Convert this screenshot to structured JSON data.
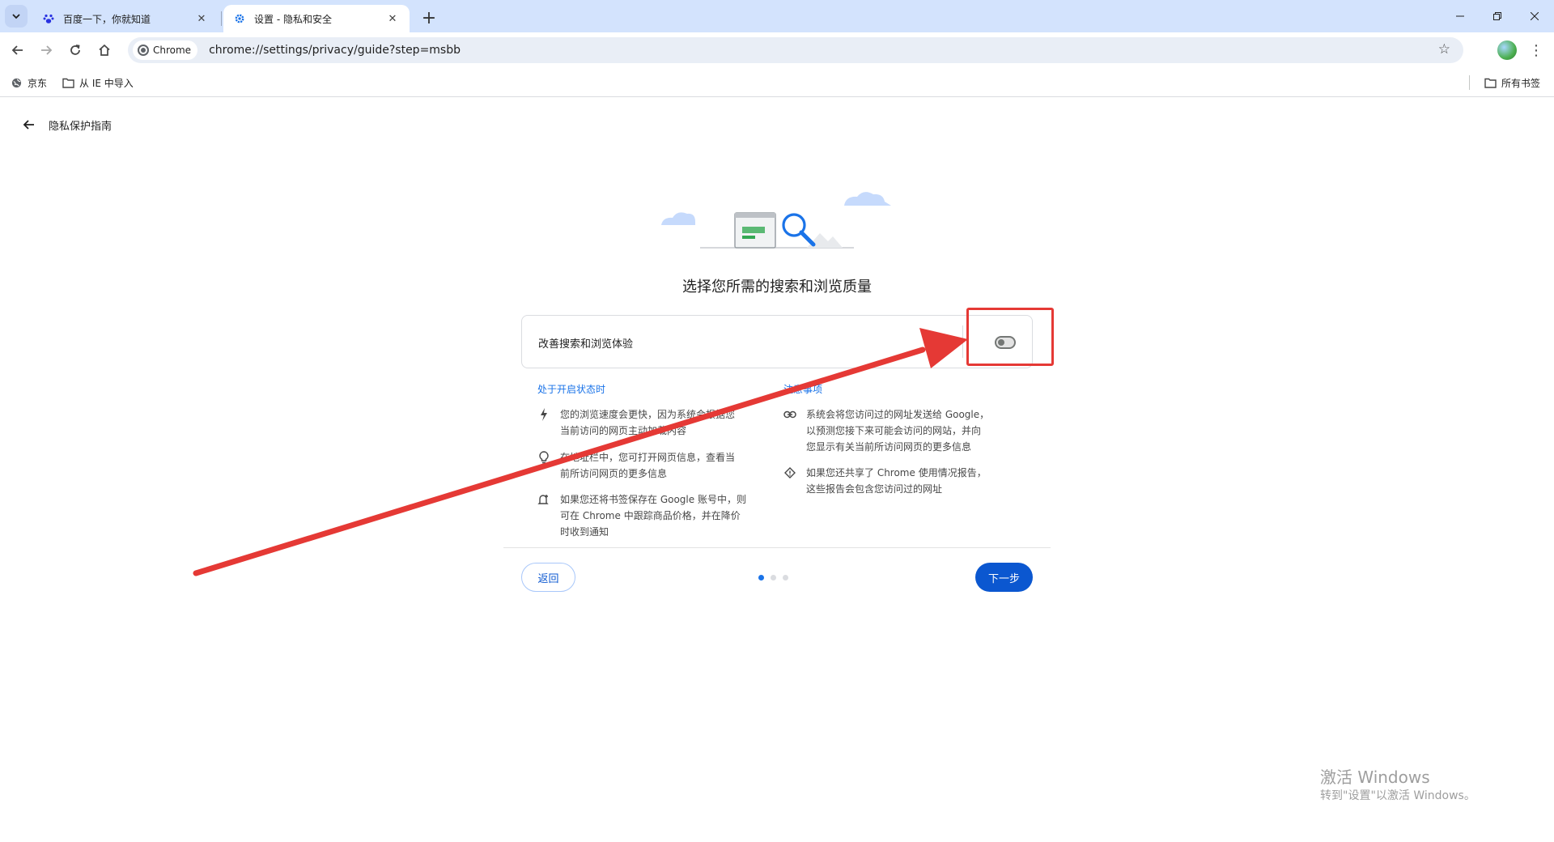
{
  "tabs": [
    {
      "title": "百度一下，你就知道",
      "icon": "baidu-paw-icon",
      "active": false
    },
    {
      "title": "设置 - 隐私和安全",
      "icon": "settings-gear-icon",
      "active": true
    }
  ],
  "toolbar": {
    "site_chip": "Chrome",
    "url": "chrome://settings/privacy/guide?step=msbb"
  },
  "bookmarks": {
    "items": [
      {
        "label": "京东",
        "icon": "globe-icon"
      },
      {
        "label": "从 IE 中导入",
        "icon": "folder-icon"
      }
    ],
    "all_bookmarks": "所有书签"
  },
  "page": {
    "heading": "隐私保护指南",
    "step_title": "选择您所需的搜索和浏览质量",
    "setting_label": "改善搜索和浏览体验",
    "toggle_on": false,
    "left_column": {
      "heading": "处于开启状态时",
      "items": [
        {
          "icon": "lightning-icon",
          "text": "您的浏览速度会更快，因为系统会根据您\n当前访问的网页主动加载内容"
        },
        {
          "icon": "lightbulb-icon",
          "text": "在地址栏中，您可打开网页信息，查看当\n前所访问网页的更多信息"
        },
        {
          "icon": "price-alert-icon",
          "text": "如果您还将书签保存在 Google 账号中，则\n可在 Chrome 中跟踪商品价格，并在降价\n时收到通知"
        }
      ]
    },
    "right_column": {
      "heading": "注意事项",
      "items": [
        {
          "icon": "link-icon",
          "text": "系统会将您访问过的网址发送给 Google，\n以预测您接下来可能会访问的网站，并向\n您显示有关当前所访问网页的更多信息"
        },
        {
          "icon": "report-icon",
          "text": "如果您还共享了 Chrome 使用情况报告，\n这些报告会包含您访问过的网址"
        }
      ]
    },
    "back_button": "返回",
    "next_button": "下一步",
    "steps_total": 3,
    "step_current": 1
  },
  "watermark": {
    "title": "激活 Windows",
    "subtitle": "转到\"设置\"以激活 Windows。"
  },
  "colors": {
    "tabstrip": "#d3e3fd",
    "accent": "#0b57d0",
    "link": "#1a73e8",
    "annotation": "#e53935"
  }
}
